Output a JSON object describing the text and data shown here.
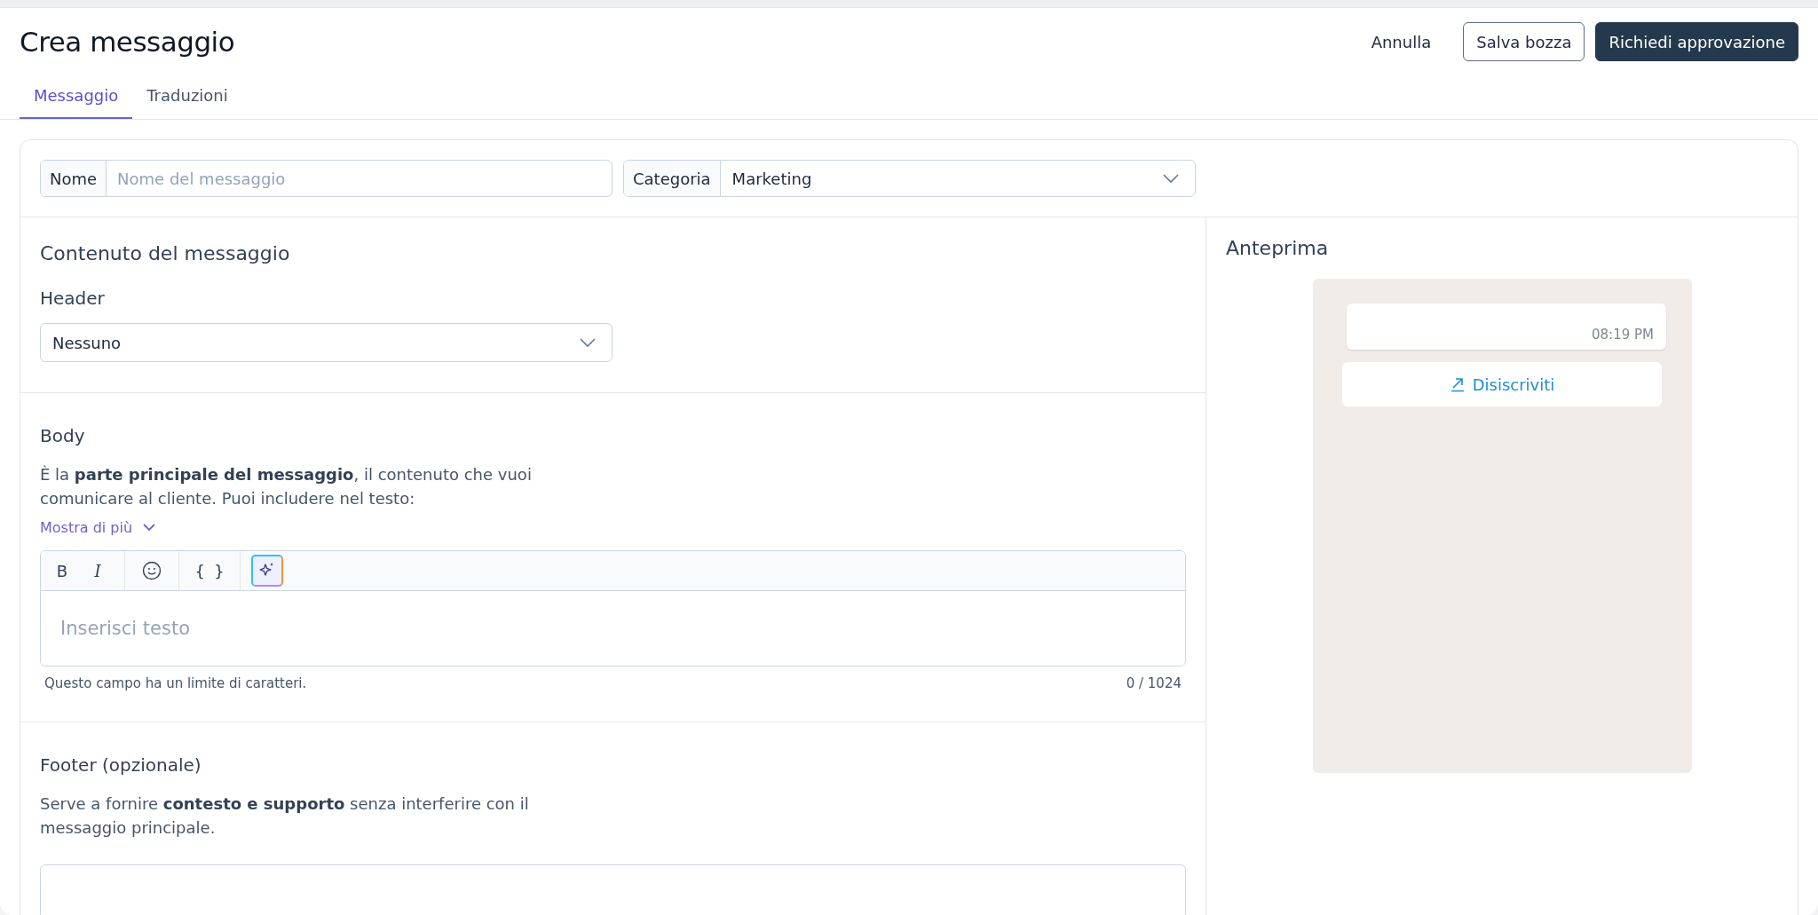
{
  "header": {
    "title": "Crea messaggio",
    "actions": [
      {
        "kind": "link",
        "label": "Annulla"
      },
      {
        "kind": "outline",
        "label": "Salva bozza"
      },
      {
        "kind": "primary",
        "label": "Richiedi approvazione"
      }
    ]
  },
  "tabs": [
    {
      "label": "Messaggio",
      "selected": true
    },
    {
      "label": "Traduzioni",
      "selected": false
    }
  ],
  "name_field": {
    "label": "Nome",
    "placeholder": "Nome del messaggio"
  },
  "category_field": {
    "label": "Categoria",
    "value": "Marketing"
  },
  "content": {
    "title": "Contenuto del messaggio",
    "header_section": {
      "title": "Header",
      "value": "Nessuno"
    },
    "body_section": {
      "title": "Body",
      "description": "È la **parte principale del messaggio**, il contenuto che vuoi comunicare al cliente. Puoi includere nel testo:",
      "show_more": "Mostra di più",
      "toolbar_groups": [
        [
          {
            "kind": "bold",
            "label": "B"
          },
          {
            "kind": "italic",
            "label": "I"
          }
        ],
        [
          {
            "kind": "emoji"
          }
        ],
        [
          {
            "kind": "variable",
            "label": "{ }"
          }
        ],
        [
          {
            "kind": "ai"
          }
        ]
      ],
      "placeholder": "Inserisci testo",
      "hint": "Questo campo ha un limite di caratteri.",
      "counter": "0 / 1024"
    },
    "footer_section": {
      "title": "Footer (opzionale)",
      "description": "Serve a fornire **contesto e supporto** senza interferire con il messaggio principale."
    }
  },
  "preview": {
    "title": "Anteprima",
    "time": "08:19 PM",
    "button": "Disiscriviti"
  }
}
